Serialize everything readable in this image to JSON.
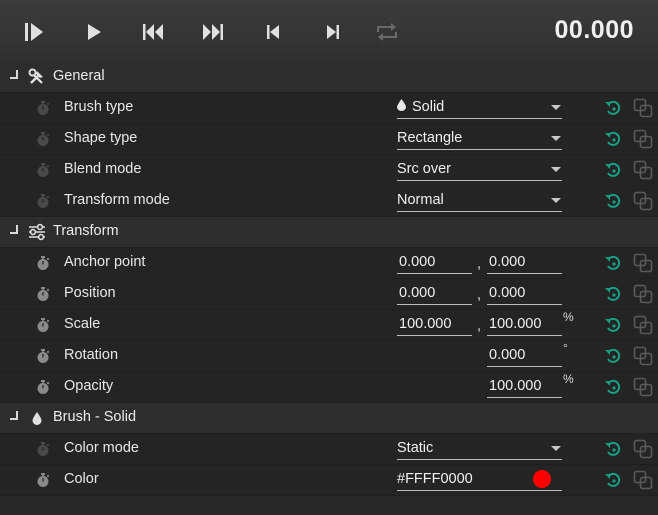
{
  "colors": {
    "accent": "#16a085",
    "link_icon": "#5a5a5a",
    "swatch": "#ff0000"
  },
  "toolbar": {
    "buttons": [
      "play-from-start-icon",
      "play-icon",
      "skip-back-icon",
      "skip-forward-icon",
      "step-back-icon",
      "step-forward-icon",
      "loop-icon"
    ],
    "timecode": "00.000"
  },
  "sections": {
    "general": {
      "title": "General",
      "icon": "tools-icon",
      "brush_type": {
        "label": "Brush type",
        "value": "Solid",
        "value_icon": "droplet-icon"
      },
      "shape_type": {
        "label": "Shape type",
        "value": "Rectangle"
      },
      "blend_mode": {
        "label": "Blend mode",
        "value": "Src over"
      },
      "transform_mode": {
        "label": "Transform mode",
        "value": "Normal"
      }
    },
    "transform": {
      "title": "Transform",
      "icon": "sliders-icon",
      "anchor_point": {
        "label": "Anchor point",
        "x": "0.000",
        "y": "0.000"
      },
      "position": {
        "label": "Position",
        "x": "0.000",
        "y": "0.000"
      },
      "scale": {
        "label": "Scale",
        "x": "100.000",
        "y": "100.000",
        "unit": "%"
      },
      "rotation": {
        "label": "Rotation",
        "value": "0.000",
        "unit": "°"
      },
      "opacity": {
        "label": "Opacity",
        "value": "100.000",
        "unit": "%"
      }
    },
    "brush_solid": {
      "title": "Brush - Solid",
      "icon": "droplet-icon",
      "color_mode": {
        "label": "Color mode",
        "value": "Static"
      },
      "color": {
        "label": "Color",
        "value": "#FFFF0000"
      }
    }
  },
  "comma": ","
}
